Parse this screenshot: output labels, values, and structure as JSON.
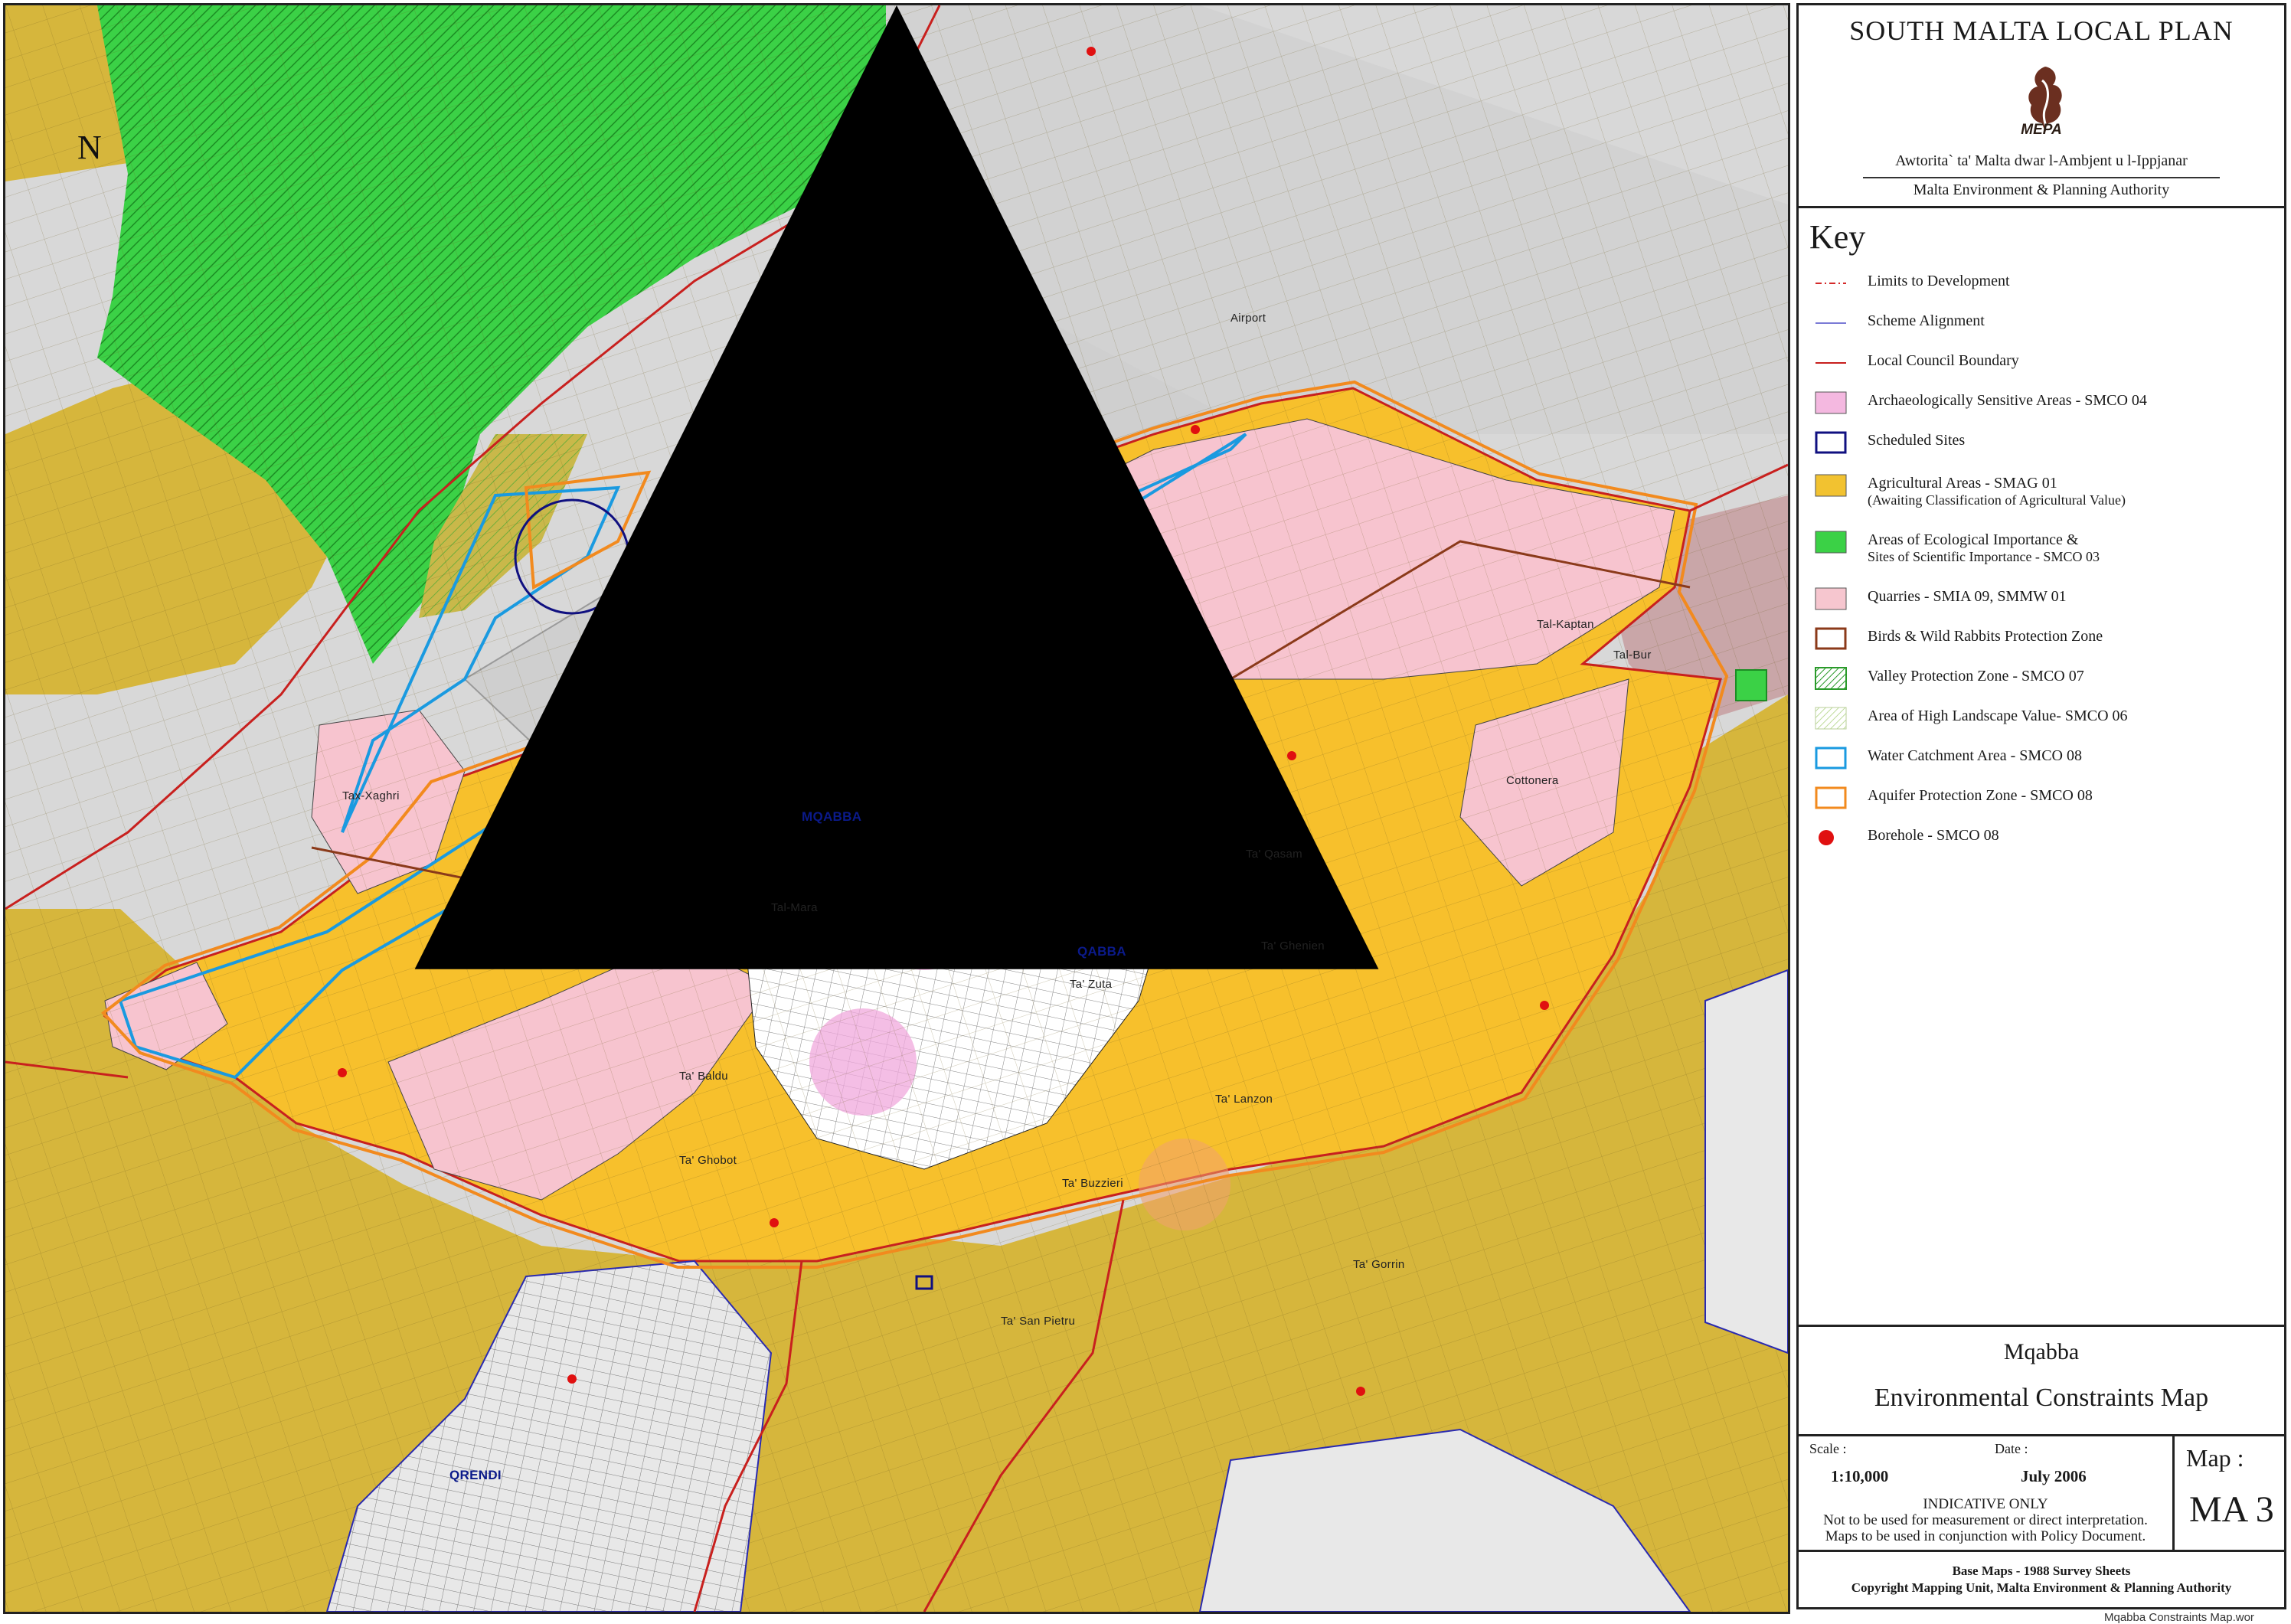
{
  "plan_title": "SOUTH MALTA LOCAL PLAN",
  "logo": {
    "text": "MEPA",
    "icon": "mepa-logo-icon"
  },
  "authority": {
    "maltese": "Awtorita` ta' Malta dwar l-Ambjent u l-Ippjanar",
    "english": "Malta Environment & Planning Authority"
  },
  "north_arrow": {
    "letter": "N",
    "icon": "north-arrow-icon"
  },
  "key": {
    "title": "Key",
    "items": [
      {
        "label": "Limits to Development",
        "symbol": "dash-dot-line",
        "color": "#d42a2a"
      },
      {
        "label": "Scheme Alignment",
        "symbol": "line",
        "color": "#7b7bd6"
      },
      {
        "label": "Local Council Boundary",
        "symbol": "line",
        "color": "#c8201e"
      },
      {
        "label": "Archaeologically Sensitive Areas - SMCO 04",
        "symbol": "fill",
        "color": "#f4b8e0"
      },
      {
        "label": "Scheduled Sites",
        "symbol": "outline",
        "color": "#101080"
      },
      {
        "label": "Agricultural Areas - SMAG 01",
        "label2": "(Awaiting Classification of Agricultural Value)",
        "symbol": "fill",
        "color": "#f2c230"
      },
      {
        "label": "Areas of Ecological Importance &",
        "label2": "Sites of Scientific Importance - SMCO 03",
        "symbol": "fill",
        "color": "#3bd146"
      },
      {
        "label": "Quarries - SMIA 09, SMMW 01",
        "symbol": "fill",
        "color": "#f6c6cf"
      },
      {
        "label": "Birds & Wild Rabbits Protection Zone",
        "symbol": "outline",
        "color": "#8b3a1a"
      },
      {
        "label": "Valley Protection Zone - SMCO 07",
        "symbol": "hatch",
        "color": "#2a9a2a"
      },
      {
        "label": "Area of High Landscape Value- SMCO 06",
        "symbol": "hatch-light",
        "color": "#a8cf78"
      },
      {
        "label": "Water Catchment Area - SMCO 08",
        "symbol": "outline",
        "color": "#1a9ae0"
      },
      {
        "label": "Aquifer Protection Zone - SMCO 08",
        "symbol": "outline",
        "color": "#f28a1e"
      },
      {
        "label": "Borehole - SMCO 08",
        "symbol": "dot",
        "color": "#e01010"
      }
    ]
  },
  "map_name": {
    "settlement": "Mqabba",
    "type": "Environmental Constraints Map"
  },
  "scale": {
    "label": "Scale :",
    "value": "1:10,000"
  },
  "date": {
    "label": "Date :",
    "value": "July 2006"
  },
  "map_number": {
    "label": "Map :",
    "value": "MA 3"
  },
  "disclaimer": {
    "line1": "INDICATIVE ONLY",
    "line2": "Not to be used for measurement or direct interpretation.",
    "line3": "Maps to be used in conjunction with Policy Document."
  },
  "credits": {
    "line1": "Base Maps - 1988 Survey Sheets",
    "line2": "Copyright Mapping Unit, Malta Environment & Planning Authority"
  },
  "file_name": "Mqabba Constraints Map.wor",
  "map_labels": [
    {
      "text": "MQABBA",
      "kind": "urban"
    },
    {
      "text": "QABBA",
      "kind": "urban"
    },
    {
      "text": "QRENDI",
      "kind": "urban"
    },
    {
      "text": "Tal-Mara",
      "kind": "place"
    },
    {
      "text": "Ta' San Pietru",
      "kind": "place"
    },
    {
      "text": "Ta' Qasam",
      "kind": "place"
    },
    {
      "text": "Cottonera",
      "kind": "place"
    },
    {
      "text": "Tal-Kaptan",
      "kind": "place"
    },
    {
      "text": "Ta' Lanzon",
      "kind": "place"
    },
    {
      "text": "Ta' Baldu",
      "kind": "place"
    },
    {
      "text": "Ta' Ghenien",
      "kind": "place"
    },
    {
      "text": "Tal-Bur",
      "kind": "place"
    },
    {
      "text": "Ta' Gorrin",
      "kind": "place"
    },
    {
      "text": "Ta' Ghobot",
      "kind": "place"
    },
    {
      "text": "Tax-Xaghri",
      "kind": "place"
    },
    {
      "text": "Ta' Zuta",
      "kind": "place"
    },
    {
      "text": "Ta' Buzzieri",
      "kind": "place"
    },
    {
      "text": "Airport",
      "kind": "place"
    }
  ]
}
